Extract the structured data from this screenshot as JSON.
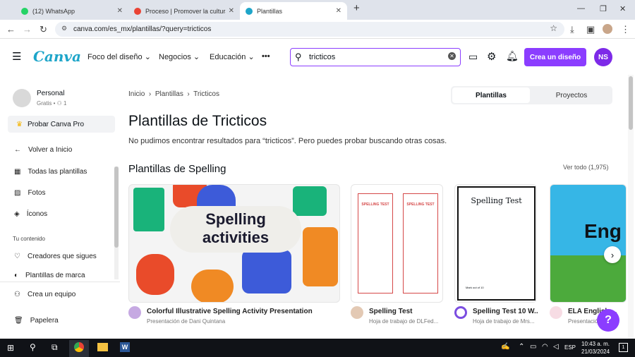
{
  "browser": {
    "tabs": [
      {
        "label": "(12) WhatsApp",
        "color": "#25d366"
      },
      {
        "label": "Proceso | Promover la cultura d...",
        "color": "#4285f4"
      },
      {
        "label": "Plantillas",
        "color": "#1ea5c9"
      }
    ],
    "url": "canva.com/es_mx/plantillas/?query=tricticos"
  },
  "header": {
    "logo": "Canva",
    "menu": [
      "Foco del diseño",
      "Negocios",
      "Educación"
    ],
    "more": "•••",
    "search_value": "tricticos",
    "create_label": "Crea un diseño",
    "avatar_initials": "NS"
  },
  "sidebar": {
    "user_name": "Personal",
    "user_plan": "Gratis",
    "user_count": "1",
    "pro_label": "Probar Canva Pro",
    "items": [
      "Volver a Inicio",
      "Todas las plantillas",
      "Fotos",
      "Íconos"
    ],
    "section_label": "Tu contenido",
    "content_items": [
      "Creadores que sigues",
      "Plantillas de marca"
    ],
    "bottom_items": [
      "Crea un equipo",
      "Papelera"
    ]
  },
  "main": {
    "breadcrumb": [
      "Inicio",
      "Plantillas",
      "Tricticos"
    ],
    "toggle": [
      "Plantillas",
      "Proyectos"
    ],
    "title": "Plantillas de Tricticos",
    "message": "No pudimos encontrar resultados para “tricticos”. Pero puedes probar buscando otras cosas.",
    "section_title": "Plantillas de Spelling",
    "see_all": "Ver todo (1,975)",
    "cards": [
      {
        "title": "Colorful Illustrative Spelling Activity Presentation",
        "sub": "Presentación de Dani Quintana",
        "art_line1": "Spelling",
        "art_line2": "activities"
      },
      {
        "title": "Spelling Test",
        "sub": "Hoja de trabajo de DLFed...",
        "art_line1": "SPELLING TEST",
        "art_line2": "SPELLING TEST"
      },
      {
        "title": "Spelling Test 10 W...",
        "sub": "Hoja de trabajo de Mrs...",
        "art_line1": "Spelling Test",
        "art_line2": "Mark out of 10"
      },
      {
        "title": "ELA English ...",
        "sub": "Presentación...",
        "art_line1": "Eng",
        "art_line2": ""
      }
    ],
    "help": "?"
  },
  "taskbar": {
    "time": "10:43 a. m.",
    "date": "21/03/2024",
    "lang": "ESP",
    "notif": "1"
  }
}
